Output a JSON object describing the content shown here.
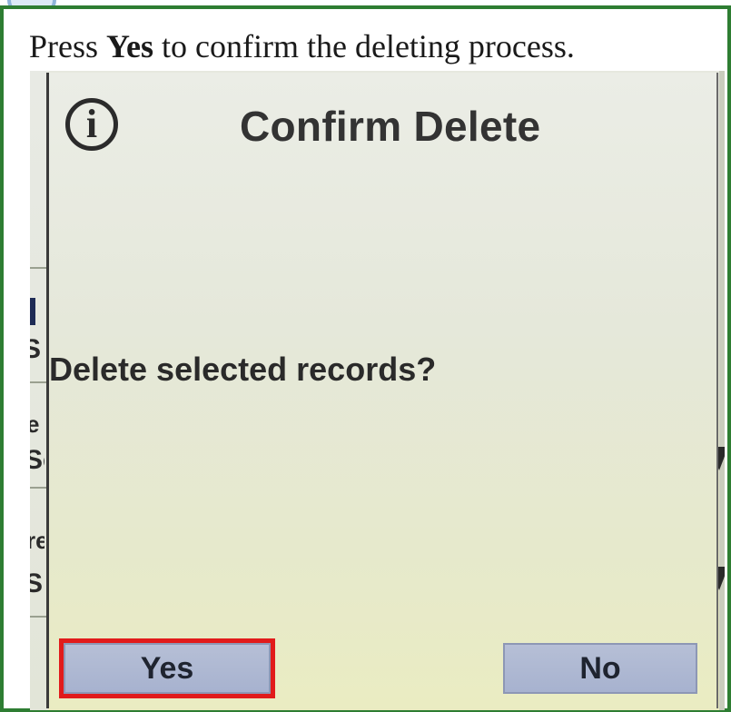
{
  "instruction": {
    "prefix": "Press ",
    "emphasis": "Yes",
    "suffix": " to confirm the deleting process."
  },
  "dialog": {
    "icon": "info-icon",
    "title": "Confirm Delete",
    "message": "Delete selected records?",
    "yes_label": "Yes",
    "no_label": "No",
    "highlighted_button": "Yes"
  },
  "background_fragments": [
    "S",
    "e",
    "Se",
    "re",
    "SI"
  ],
  "colors": {
    "frame_border": "#2e7d32",
    "highlight": "#e11b1b",
    "button_fill": "#aeb8d2"
  }
}
